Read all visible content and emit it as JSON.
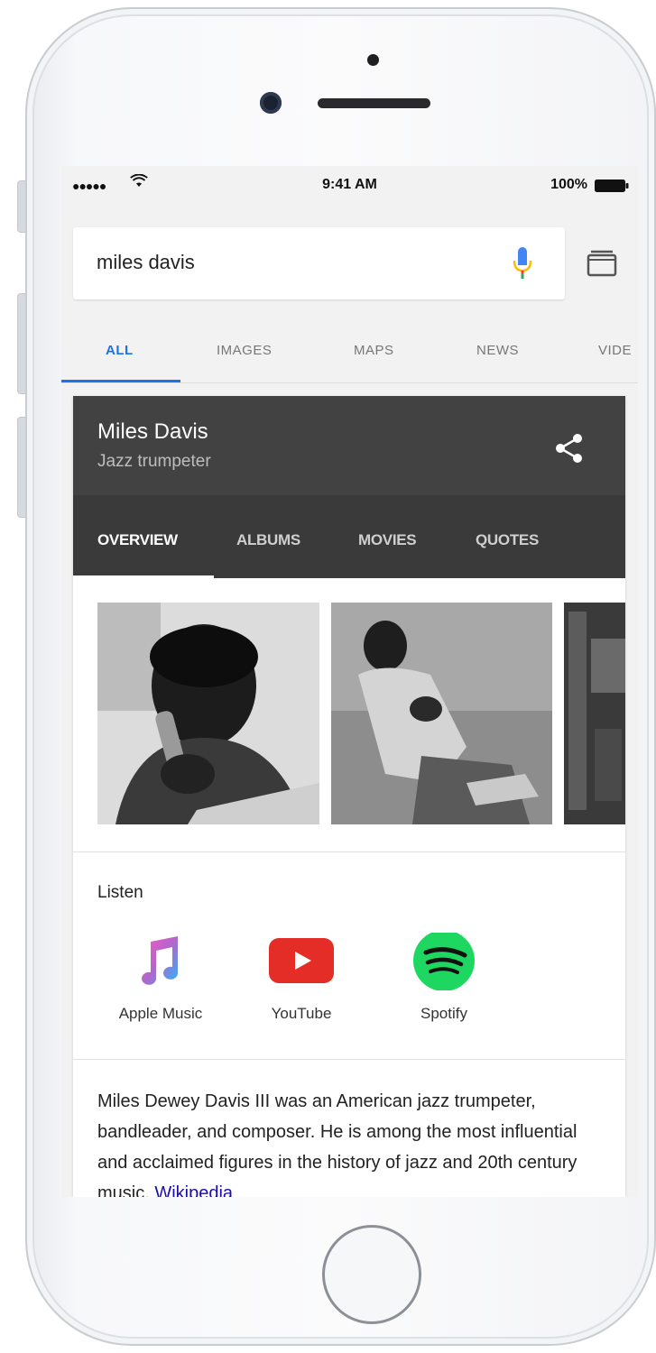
{
  "status_bar": {
    "signal": "●●●●●",
    "time": "9:41 AM",
    "battery_percent": "100%"
  },
  "search": {
    "query": "miles davis",
    "icons": [
      "mic-icon",
      "tabs-icon"
    ]
  },
  "nav_tabs": [
    {
      "label": "ALL",
      "active": true
    },
    {
      "label": "IMAGES"
    },
    {
      "label": "MAPS"
    },
    {
      "label": "NEWS"
    },
    {
      "label": "VIDE"
    }
  ],
  "knowledge_panel": {
    "title": "Miles Davis",
    "subtitle": "Jazz trumpeter",
    "tabs": [
      {
        "label": "OVERVIEW",
        "active": true
      },
      {
        "label": "ALBUMS"
      },
      {
        "label": "MOVIES"
      },
      {
        "label": "QUOTES"
      }
    ],
    "listen": {
      "title": "Listen",
      "services": [
        {
          "label": "Apple Music",
          "icon": "apple-music-icon"
        },
        {
          "label": "YouTube",
          "icon": "youtube-icon",
          "color": "#e52d27"
        },
        {
          "label": "Spotify",
          "icon": "spotify-icon",
          "color": "#1ed760"
        }
      ]
    },
    "description": "Miles Dewey Davis III was an American jazz trumpeter, bandleader, and composer. He is among the most influential and acclaimed figures in the history of jazz and 20th century music.",
    "description_link": "Wikipedia"
  },
  "colors": {
    "accent_blue": "#1a73e8",
    "header_dark": "#424242",
    "link": "#1a0dab"
  }
}
